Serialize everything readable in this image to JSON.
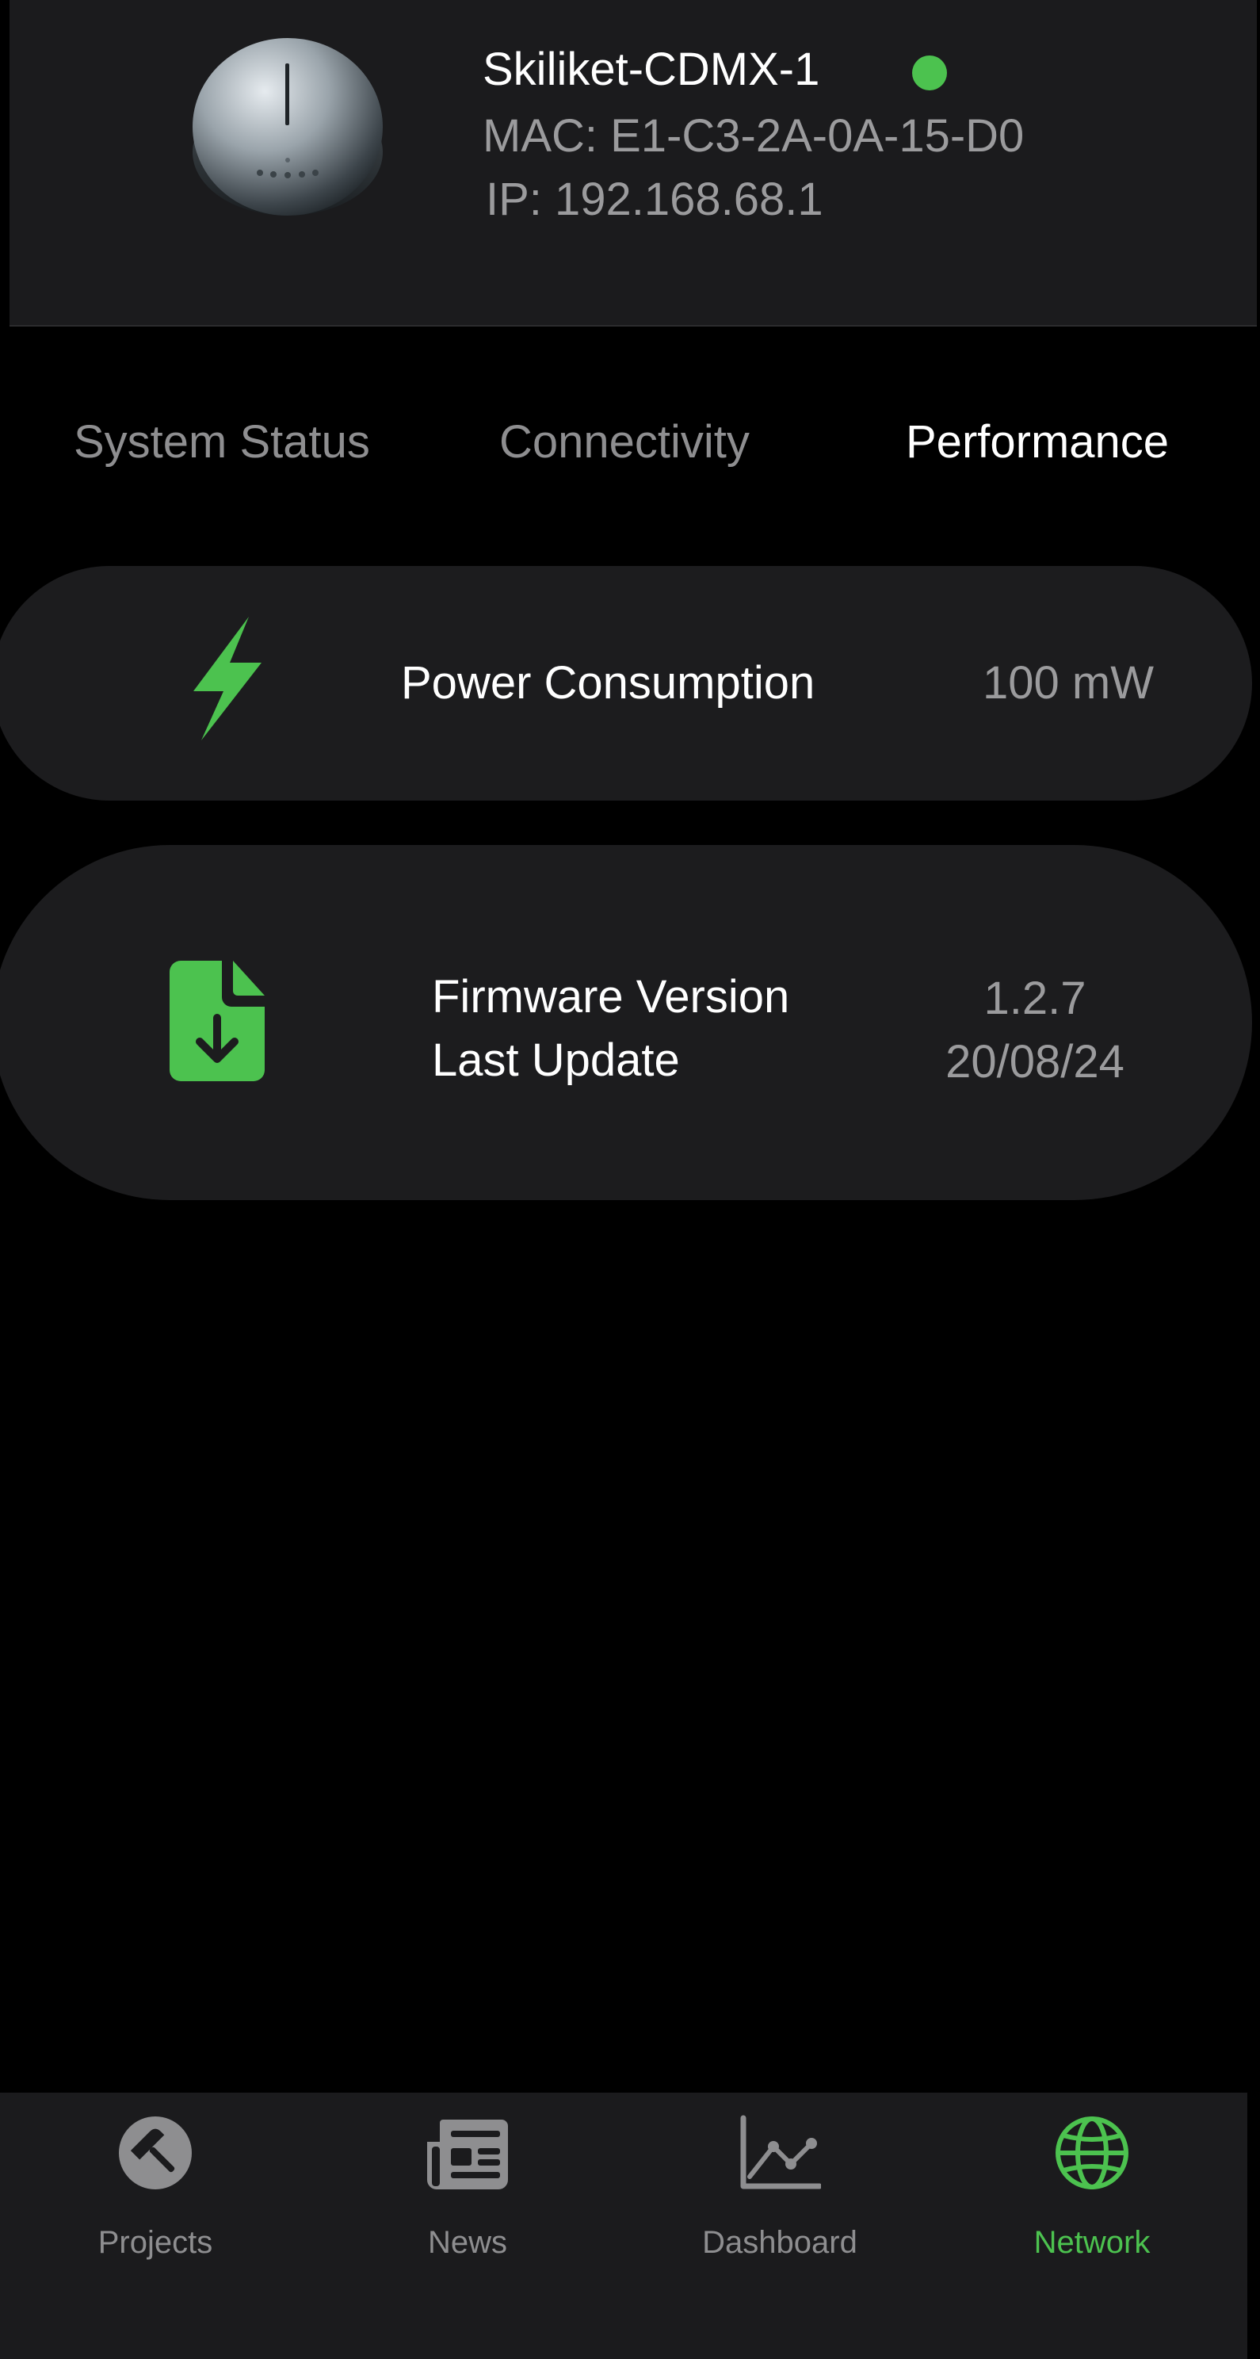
{
  "device": {
    "name": "Skiliket-CDMX-1",
    "mac": "MAC: E1-C3-2A-0A-15-D0",
    "ip": "IP: 192.168.68.1",
    "status_color": "#4cc24f"
  },
  "tabs": [
    {
      "label": "System Status",
      "active": false
    },
    {
      "label": "Connectivity",
      "active": false
    },
    {
      "label": "Performance",
      "active": true
    }
  ],
  "cards": {
    "power": {
      "icon": "lightning-bolt-icon",
      "label": "Power Consumption",
      "value": "100 mW"
    },
    "firmware": {
      "icon": "file-download-icon",
      "label_version": "Firmware Version",
      "label_update": "Last Update",
      "value_version": "1.2.7",
      "value_update": "20/08/24"
    }
  },
  "nav": [
    {
      "label": "Projects",
      "icon": "hammer-icon",
      "active": false
    },
    {
      "label": "News",
      "icon": "newspaper-icon",
      "active": false
    },
    {
      "label": "Dashboard",
      "icon": "line-chart-icon",
      "active": false
    },
    {
      "label": "Network",
      "icon": "globe-icon",
      "active": true
    }
  ],
  "colors": {
    "accent": "#4cc24f",
    "background": "#000000",
    "card": "#1c1c1e",
    "muted_text": "#9b9b9d"
  }
}
